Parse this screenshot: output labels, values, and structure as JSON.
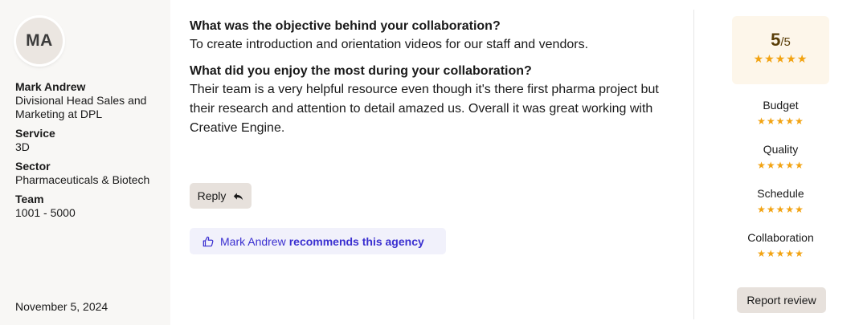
{
  "reviewer": {
    "initials": "MA",
    "name": "Mark Andrew",
    "title": "Divisional Head Sales and Marketing at DPL",
    "service_label": "Service",
    "service": "3D",
    "sector_label": "Sector",
    "sector": "Pharmaceuticals & Biotech",
    "team_label": "Team",
    "team": "1001 - 5000",
    "date": "November 5, 2024"
  },
  "review": {
    "q1": "What was the objective behind your collaboration?",
    "a1": "To create introduction and orientation videos for our staff and vendors.",
    "q2": "What did you enjoy the most during your collaboration?",
    "a2": "Their team is a very helpful resource even though it's there first pharma project but their research and attention to detail amazed us. Overall it was great working with Creative Engine."
  },
  "actions": {
    "reply_label": "Reply",
    "recommend_name": "Mark Andrew",
    "recommend_text": "recommends this agency",
    "report_label": "Report review"
  },
  "rating": {
    "score": "5",
    "out_of": "/5",
    "stars": "★★★★★",
    "categories": [
      {
        "label": "Budget",
        "stars": "★★★★★"
      },
      {
        "label": "Quality",
        "stars": "★★★★★"
      },
      {
        "label": "Schedule",
        "stars": "★★★★★"
      },
      {
        "label": "Collaboration",
        "stars": "★★★★★"
      }
    ]
  },
  "colors": {
    "star": "#f2a312",
    "accent": "#3a2fd0",
    "sidebar_bg": "#f8f7f5",
    "rating_bg": "#fdf6ea"
  },
  "icons": {
    "reply": "reply-arrow-icon",
    "recommend": "thumbs-up-icon"
  }
}
